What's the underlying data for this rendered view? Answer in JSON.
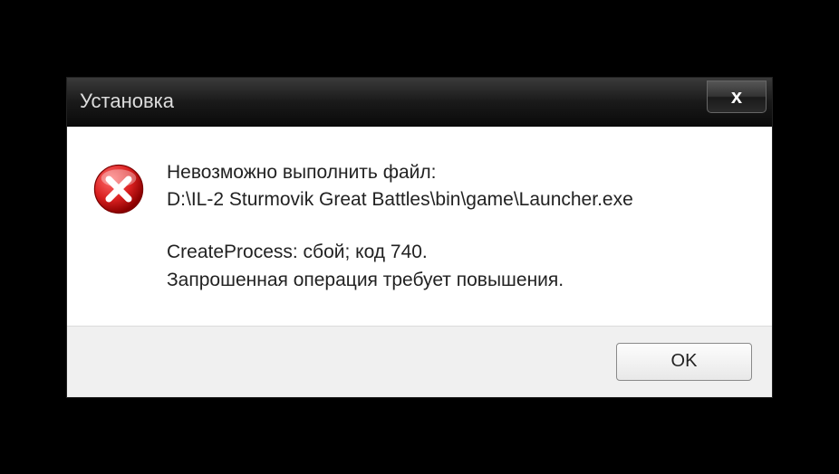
{
  "dialog": {
    "title": "Установка",
    "message": {
      "line1": "Невозможно выполнить файл:",
      "line2": "D:\\IL-2 Sturmovik Great Battles\\bin\\game\\Launcher.exe",
      "line3": "CreateProcess: сбой; код 740.",
      "line4": "Запрошенная операция требует повышения."
    },
    "ok_label": "OK"
  },
  "icons": {
    "close": "x",
    "error": "error-icon"
  }
}
